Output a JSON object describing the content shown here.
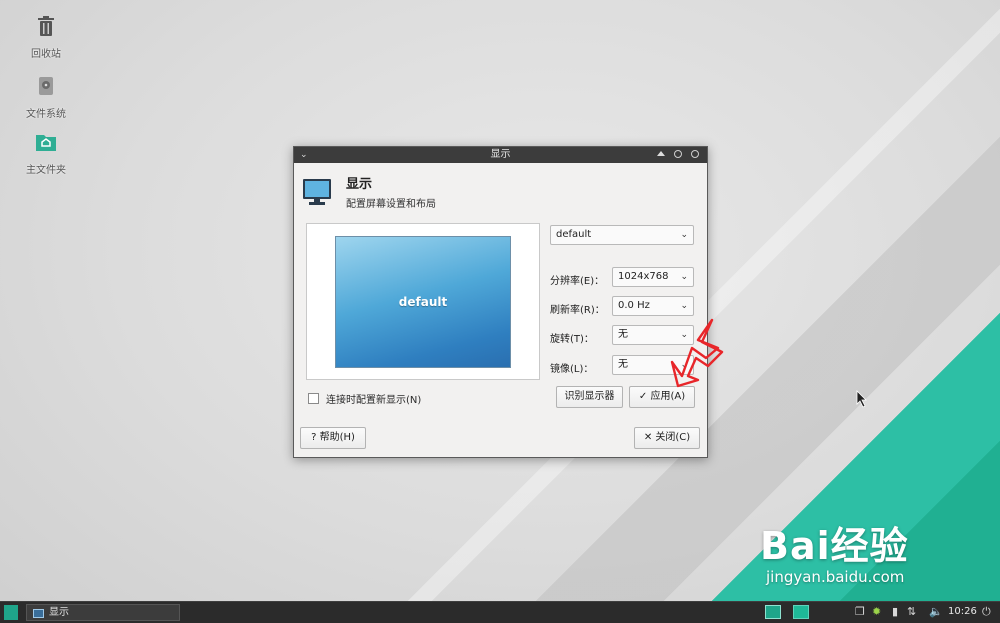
{
  "desktop": {
    "icons": [
      {
        "label": "回收站",
        "icon": "trash-icon"
      },
      {
        "label": "文件系统",
        "icon": "drive-icon"
      },
      {
        "label": "主文件夹",
        "icon": "home-folder-icon"
      }
    ]
  },
  "window": {
    "title": "显示",
    "header_title": "显示",
    "header_subtitle": "配置屏幕设置和布局",
    "preview_label": "default",
    "display_select": "default",
    "fields": {
      "resolution_label": "分辨率(E)：",
      "resolution_value": "1024x768",
      "refresh_label": "刷新率(R)：",
      "refresh_value": "0.0 Hz",
      "rotation_label": "旋转(T)：",
      "rotation_value": "无",
      "mirror_label": "镜像(L)：",
      "mirror_value": "无"
    },
    "checkbox_label": "连接时配置新显示(N)",
    "identify_button": "识别显示器",
    "apply_button": "应用(A)",
    "help_button": "帮助(H)",
    "close_button": "关闭(C)"
  },
  "watermark": {
    "logo": "Bai经验",
    "url": "jingyan.baidu.com"
  },
  "taskbar": {
    "task_label": "显示",
    "clock": "10:26"
  },
  "colors": {
    "accent": "#1fa58a",
    "titlebar": "#3c3c3c",
    "annotation": "#e8262a"
  }
}
